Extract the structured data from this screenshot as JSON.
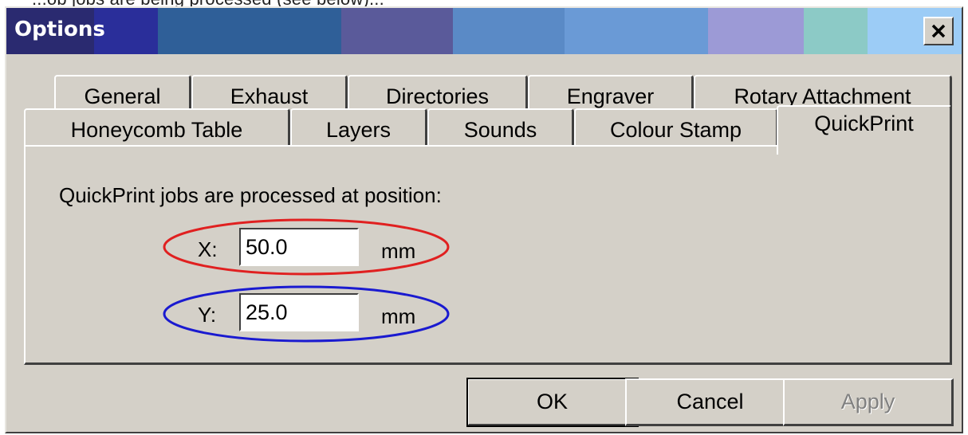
{
  "top_fragment": "...ob jobs are being processed (see below)...",
  "window": {
    "title": "Options"
  },
  "tabs": {
    "row1": [
      "General",
      "Exhaust",
      "Directories",
      "Engraver",
      "Rotary Attachment"
    ],
    "row2": [
      "Honeycomb Table",
      "Layers",
      "Sounds",
      "Colour Stamp",
      "QuickPrint"
    ],
    "active": "QuickPrint"
  },
  "quickprint": {
    "description": "QuickPrint jobs are processed at position:",
    "x": {
      "label": "X:",
      "value": "50.0",
      "unit": "mm"
    },
    "y": {
      "label": "Y:",
      "value": "25.0",
      "unit": "mm"
    }
  },
  "annotations": {
    "x_oval_color": "#e02020",
    "y_oval_color": "#1a1ad0"
  },
  "buttons": {
    "ok": "OK",
    "cancel": "Cancel",
    "apply": "Apply"
  },
  "icons": {
    "close": "close-icon"
  }
}
